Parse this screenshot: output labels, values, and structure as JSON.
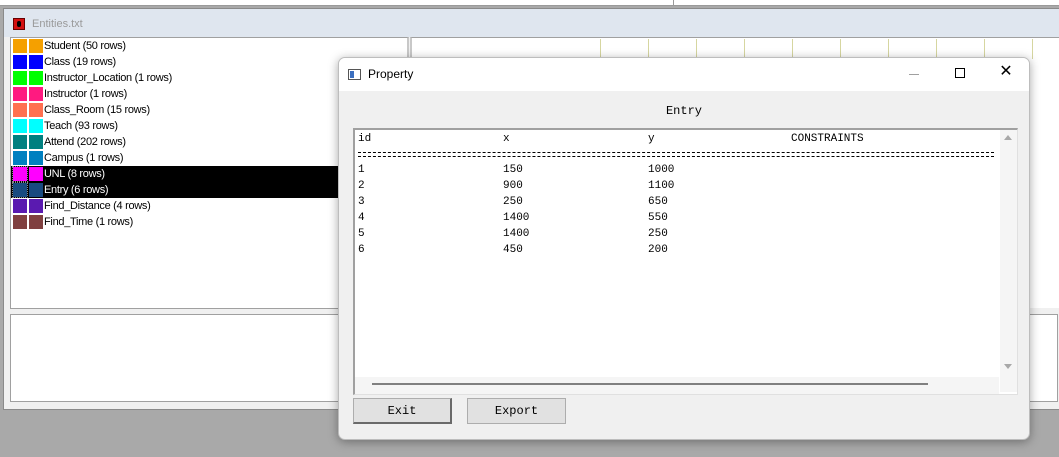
{
  "entities_window": {
    "title": "Entities.txt",
    "items": [
      {
        "label": "Student (50 rows)",
        "color": "#f5a000",
        "selected": false
      },
      {
        "label": "Class (19 rows)",
        "color": "#0000ff",
        "selected": false
      },
      {
        "label": "Instructor_Location (1 rows)",
        "color": "#00ff00",
        "selected": false
      },
      {
        "label": "Instructor (1 rows)",
        "color": "#ff1a80",
        "selected": false
      },
      {
        "label": "Class_Room (15 rows)",
        "color": "#ff7050",
        "selected": false
      },
      {
        "label": "Teach (93 rows)",
        "color": "#00ffff",
        "selected": false
      },
      {
        "label": "Attend (202 rows)",
        "color": "#008080",
        "selected": false
      },
      {
        "label": "Campus (1 rows)",
        "color": "#0080c0",
        "selected": false
      },
      {
        "label": "UNL (8 rows)",
        "color": "#ff00ff",
        "selected": true
      },
      {
        "label": "Entry (6 rows)",
        "color": "#184a80",
        "selected": true
      },
      {
        "label": "Find_Distance (4 rows)",
        "color": "#5a1ab0",
        "selected": false
      },
      {
        "label": "Find_Time (1 rows)",
        "color": "#804040",
        "selected": false
      }
    ]
  },
  "property_dialog": {
    "title": "Property",
    "entity_name": "Entry",
    "columns": {
      "id": "id",
      "x": "x",
      "y": "y",
      "constraints": "CONSTRAINTS"
    },
    "rows": [
      {
        "id": "1",
        "x": "150",
        "y": "1000"
      },
      {
        "id": "2",
        "x": "900",
        "y": "1100"
      },
      {
        "id": "3",
        "x": "250",
        "y": "650"
      },
      {
        "id": "4",
        "x": "1400",
        "y": "550"
      },
      {
        "id": "5",
        "x": "1400",
        "y": "250"
      },
      {
        "id": "6",
        "x": "450",
        "y": "200"
      }
    ],
    "buttons": {
      "exit": "Exit",
      "export": "Export"
    },
    "window_controls": {
      "minimize": "—",
      "maximize": "☐",
      "close": "✕"
    }
  }
}
